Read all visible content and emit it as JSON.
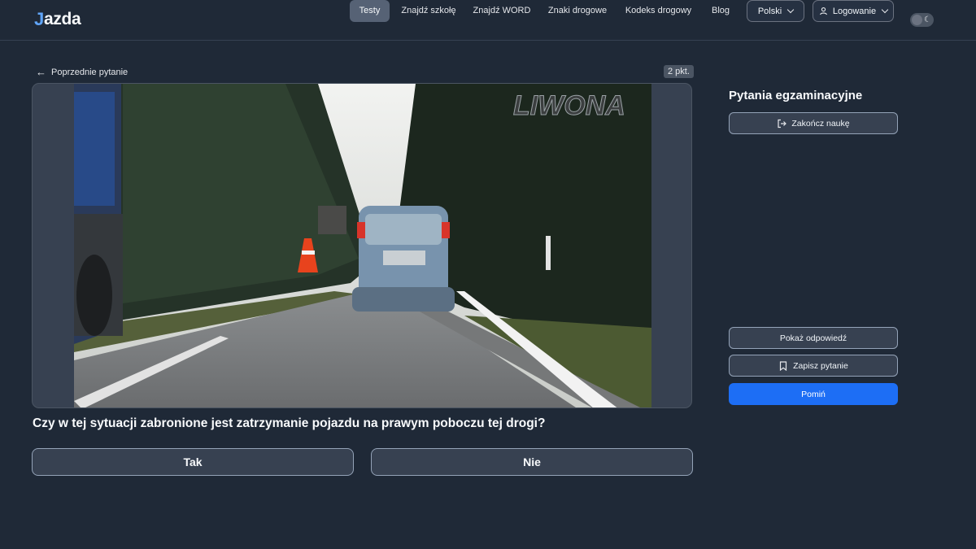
{
  "header": {
    "logo_mark": "J",
    "logo_text": "azda",
    "nav": [
      {
        "label": "Testy",
        "active": true
      },
      {
        "label": "Znajdź szkołę"
      },
      {
        "label": "Znajdź WORD"
      },
      {
        "label": "Znaki drogowe"
      },
      {
        "label": "Kodeks drogowy"
      },
      {
        "label": "Blog"
      }
    ],
    "language": "Polski",
    "login": "Logowanie",
    "theme_icon": "moon-icon"
  },
  "question_panel": {
    "back_label": "Poprzednie pytanie",
    "points": "2 pkt.",
    "image_watermark": "LIWONA",
    "question_text": "Czy w tej sytuacji zabronione jest zatrzymanie pojazdu na prawym poboczu tej drogi?",
    "answers": [
      "Tak",
      "Nie"
    ]
  },
  "sidebar": {
    "title": "Pytania egzaminacyjne",
    "end_label": "Zakończ naukę",
    "show_answer_label": "Pokaż odpowiedź",
    "save_label": "Zapisz pytanie",
    "skip_label": "Pomiń"
  },
  "colors": {
    "background": "#1f2937",
    "accent": "#1d6ef5",
    "logo_accent": "#60a5fa"
  }
}
